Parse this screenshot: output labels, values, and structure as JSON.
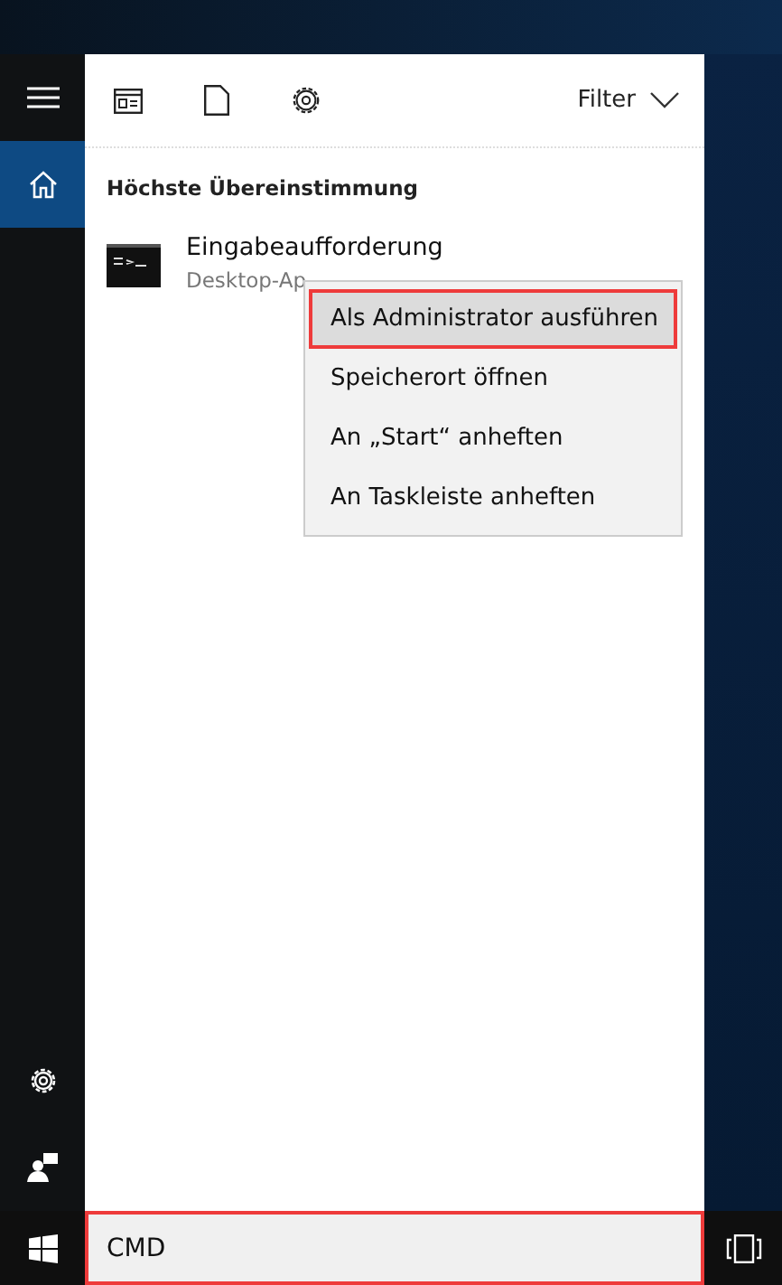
{
  "sidebar": {
    "top_items": [
      {
        "kind": "menu",
        "selected": false
      },
      {
        "kind": "home",
        "selected": true
      }
    ],
    "bottom_items": [
      {
        "kind": "settings",
        "selected": false
      },
      {
        "kind": "feedback",
        "selected": false
      }
    ]
  },
  "toolbar": {
    "icons": [
      {
        "kind": "apps"
      },
      {
        "kind": "document"
      },
      {
        "kind": "settings"
      }
    ],
    "filter": "Filter"
  },
  "section_title": "Höchste Übereinstimmung",
  "result": {
    "title": "Eingabeaufforderung",
    "subtitle": "Desktop-Ap"
  },
  "context_menu": [
    {
      "label": "Als Administrator ausführen",
      "highlighted": true
    },
    {
      "label": "Speicherort öffnen",
      "highlighted": false
    },
    {
      "label": "An „Start“ anheften",
      "highlighted": false
    },
    {
      "label": "An Taskleiste anheften",
      "highlighted": false
    }
  ],
  "taskbar": {
    "search": {
      "value": "CMD",
      "highlighted": true
    }
  }
}
